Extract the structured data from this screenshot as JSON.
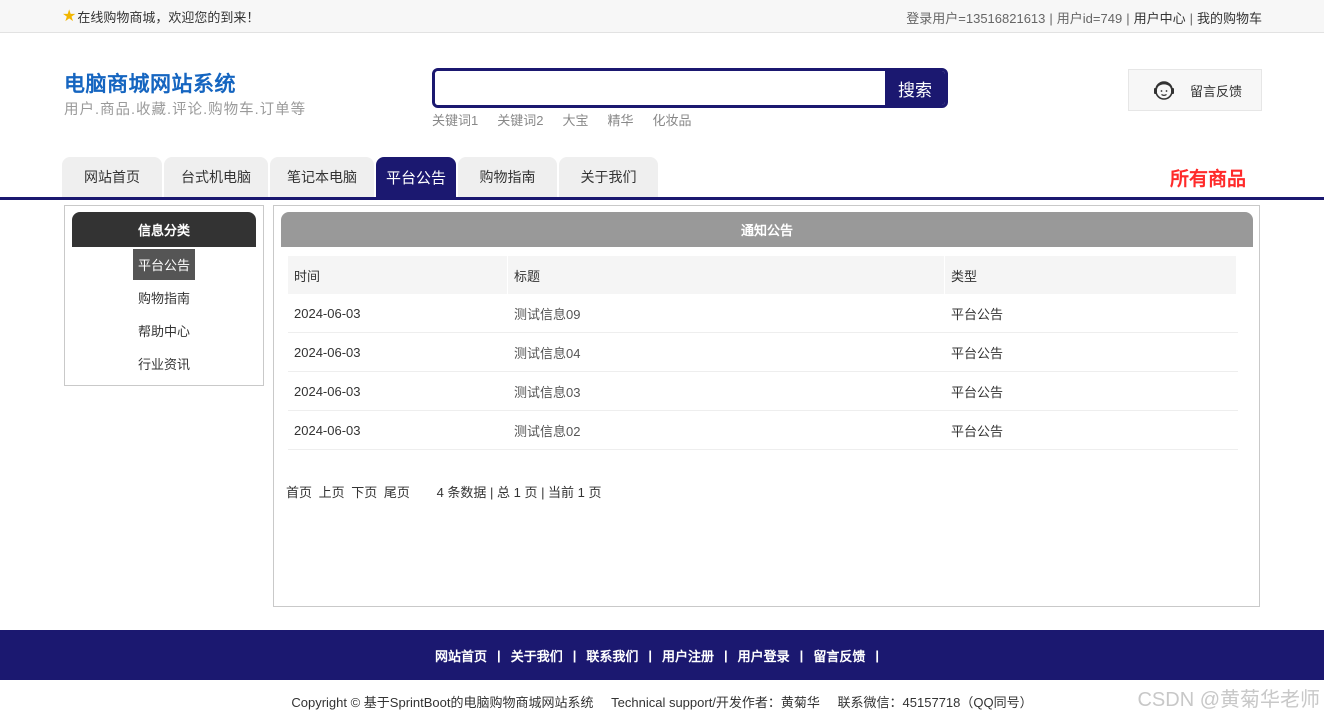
{
  "topbar": {
    "welcome": "在线购物商城，欢迎您的到来！",
    "login_user": "登录用户=13516821613",
    "user_id": "用户id=749",
    "user_center": "用户中心",
    "cart": "我的购物车"
  },
  "header": {
    "title": "电脑商城网站系统",
    "subtitle": "用户.商品.收藏.评论.购物车.订单等",
    "search": {
      "placeholder": "",
      "value": "",
      "button": "搜索"
    },
    "hotwords": [
      "关键词1",
      "关键词2",
      "大宝",
      "精华",
      "化妆品"
    ],
    "feedback": "留言反馈"
  },
  "nav": {
    "tabs": [
      {
        "label": "网站首页"
      },
      {
        "label": "台式机电脑"
      },
      {
        "label": "笔记本电脑"
      },
      {
        "label": "平台公告"
      },
      {
        "label": "购物指南"
      },
      {
        "label": "关于我们"
      }
    ],
    "active_index": 3,
    "all_goods": "所有商品"
  },
  "sidebar": {
    "title": "信息分类",
    "items": [
      "平台公告",
      "购物指南",
      "帮助中心",
      "行业资讯"
    ],
    "active_index": 0
  },
  "main": {
    "title": "通知公告",
    "columns": [
      "时间",
      "标题",
      "类型"
    ],
    "rows": [
      {
        "date": "2024-06-03",
        "title": "测试信息09",
        "type": "平台公告"
      },
      {
        "date": "2024-06-03",
        "title": "测试信息04",
        "type": "平台公告"
      },
      {
        "date": "2024-06-03",
        "title": "测试信息03",
        "type": "平台公告"
      },
      {
        "date": "2024-06-03",
        "title": "测试信息02",
        "type": "平台公告"
      }
    ],
    "pager": {
      "first": "首页",
      "prev": "上页",
      "next": "下页",
      "last": "尾页",
      "info": "4 条数据 | 总 1 页 | 当前 1 页"
    }
  },
  "footer": {
    "links": [
      "网站首页",
      "关于我们",
      "联系我们",
      "用户注册",
      "用户登录",
      "留言反馈"
    ],
    "copyright": "Copyright © 基于SprintBoot的电脑购物商城网站系统",
    "support": "Technical support/开发作者：黄菊华",
    "wechat": "联系微信：45157718（QQ同号）",
    "watermark": "CSDN @黄菊华老师"
  },
  "colors": {
    "brand": "#1b1870",
    "title_blue": "#1565c0",
    "all_goods_red": "#ff2a2a"
  }
}
